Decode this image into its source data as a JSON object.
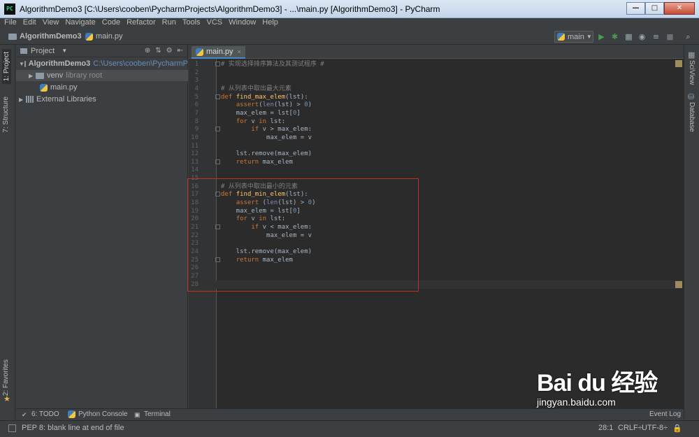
{
  "window": {
    "title": "AlgorithmDemo3 [C:\\Users\\cooben\\PycharmProjects\\AlgorithmDemo3] - ...\\main.py [AlgorithmDemo3] - PyCharm",
    "app_icon_label": "PC",
    "minimize": "—",
    "maximize": "□",
    "close": "✕"
  },
  "menu": [
    "File",
    "Edit",
    "View",
    "Navigate",
    "Code",
    "Refactor",
    "Run",
    "Tools",
    "VCS",
    "Window",
    "Help"
  ],
  "navbar": {
    "project_crumb": "AlgorithmDemo3",
    "file_crumb": "main.py",
    "run_config": "main"
  },
  "left_stripe": {
    "project_tab": "1: Project",
    "structure_tab": "7: Structure",
    "favorites_tab": "2: Favorites"
  },
  "right_stripe": {
    "sciview_tab": "SciView",
    "database_tab": "Database"
  },
  "project_panel": {
    "title": "Project",
    "tree": [
      {
        "label": "AlgorithmDemo3",
        "path": "C:\\Users\\cooben\\PycharmP",
        "arrow": "▼"
      },
      {
        "label": "venv",
        "path": "library root",
        "arrow": "▶"
      },
      {
        "label": "main.py",
        "path": "",
        "arrow": ""
      },
      {
        "label": "External Libraries",
        "path": "",
        "arrow": "▶"
      }
    ]
  },
  "editor": {
    "tab_label": "main.py",
    "tab_close": "×",
    "lines": [
      "# 实现选择排序算法及其测试程序 #",
      "",
      "",
      "# 从列表中取出最大元素",
      "def find_max_elem(lst):",
      "    assert(len(lst) > 0)",
      "    max_elem = lst[0]",
      "    for v in lst:",
      "        if v > max_elem:",
      "            max_elem = v",
      "",
      "    lst.remove(max_elem)",
      "    return max_elem",
      "",
      "",
      "# 从列表中取出最小的元素",
      "def find_min_elem(lst):",
      "    assert (len(lst) > 0)",
      "    max_elem = lst[0]",
      "    for v in lst:",
      "        if v < max_elem:",
      "            max_elem = v",
      "",
      "    lst.remove(max_elem)",
      "    return max_elem",
      "",
      "",
      ""
    ]
  },
  "bottom_tools": {
    "todo": "6: TODO",
    "python_console": "Python Console",
    "terminal": "Terminal",
    "event_log": "Event Log"
  },
  "status": {
    "message": "PEP 8: blank line at end of file",
    "position": "28:1",
    "line_sep": "CRLF÷",
    "encoding": "UTF-8÷"
  },
  "watermark": {
    "logo": "Bai du 经验",
    "url": "jingyan.baidu.com"
  },
  "colors": {
    "background": "#3c3f41",
    "editor_bg": "#2b2b2b",
    "keyword": "#cc7832",
    "function": "#ffc66d",
    "comment": "#808080",
    "number": "#6897bb",
    "highlight_box": "#c0302a",
    "run_green": "#499c54"
  }
}
